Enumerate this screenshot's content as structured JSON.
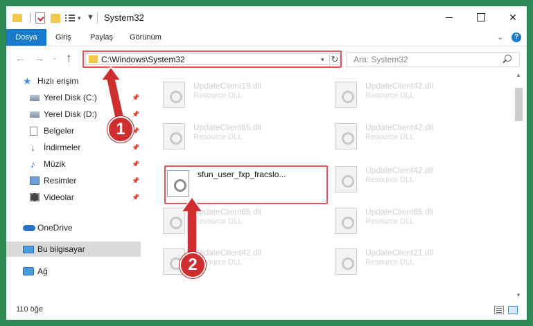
{
  "window": {
    "title": "System32",
    "controls": {
      "close": "✕"
    }
  },
  "ribbon": {
    "tabs": [
      "Dosya",
      "Giriş",
      "Paylaş",
      "Görünüm"
    ],
    "help": "?"
  },
  "address": {
    "path": "C:\\Windows\\System32",
    "search_placeholder": "Ara: System32"
  },
  "sidebar": {
    "items": [
      {
        "label": "Hızlı erişim",
        "icon": "star-icon"
      },
      {
        "label": "Yerel Disk (C:)",
        "icon": "drive-icon",
        "pinned": true
      },
      {
        "label": "Yerel Disk (D:)",
        "icon": "drive-icon",
        "pinned": true
      },
      {
        "label": "Belgeler",
        "icon": "documents-icon",
        "pinned": true
      },
      {
        "label": "İndirmeler",
        "icon": "download-icon",
        "pinned": true
      },
      {
        "label": "Müzik",
        "icon": "music-icon",
        "pinned": true
      },
      {
        "label": "Resimler",
        "icon": "pictures-icon",
        "pinned": true
      },
      {
        "label": "Videolar",
        "icon": "video-icon",
        "pinned": true
      },
      {
        "label": "OneDrive",
        "icon": "cloud-icon"
      },
      {
        "label": "Bu bilgisayar",
        "icon": "computer-icon",
        "selected": true
      },
      {
        "label": "Ağ",
        "icon": "network-icon"
      }
    ]
  },
  "files": [
    {
      "name": "UpdateClient19.dll",
      "type": "Resource DLL"
    },
    {
      "name": "UpdateClient42.dll",
      "type": "Resource DLL"
    },
    {
      "name": "UpdateClient65.dll",
      "type": "Resource DLL"
    },
    {
      "name": "UpdateClient42.dll",
      "type": "Resource DLL"
    },
    {
      "name": "sfun_user_fxp_fracslo...",
      "type": "",
      "highlighted": true
    },
    {
      "name": "UpdateClient42.dll",
      "type": "Resource DLL"
    },
    {
      "name": "UpdateClient65.dll",
      "type": "Resource DLL"
    },
    {
      "name": "UpdateClient65.dll",
      "type": "Resource DLL"
    },
    {
      "name": "UpdateClient42.dll",
      "type": "Resource DLL"
    },
    {
      "name": "UpdateClient21.dll",
      "type": "Resource DLL"
    }
  ],
  "status": {
    "item_count": "110 öğe"
  },
  "annotations": {
    "step1": "1",
    "step2": "2"
  },
  "colors": {
    "accent": "#1979ca",
    "annotation": "#cf2e2e",
    "background": "#2e8b57"
  }
}
